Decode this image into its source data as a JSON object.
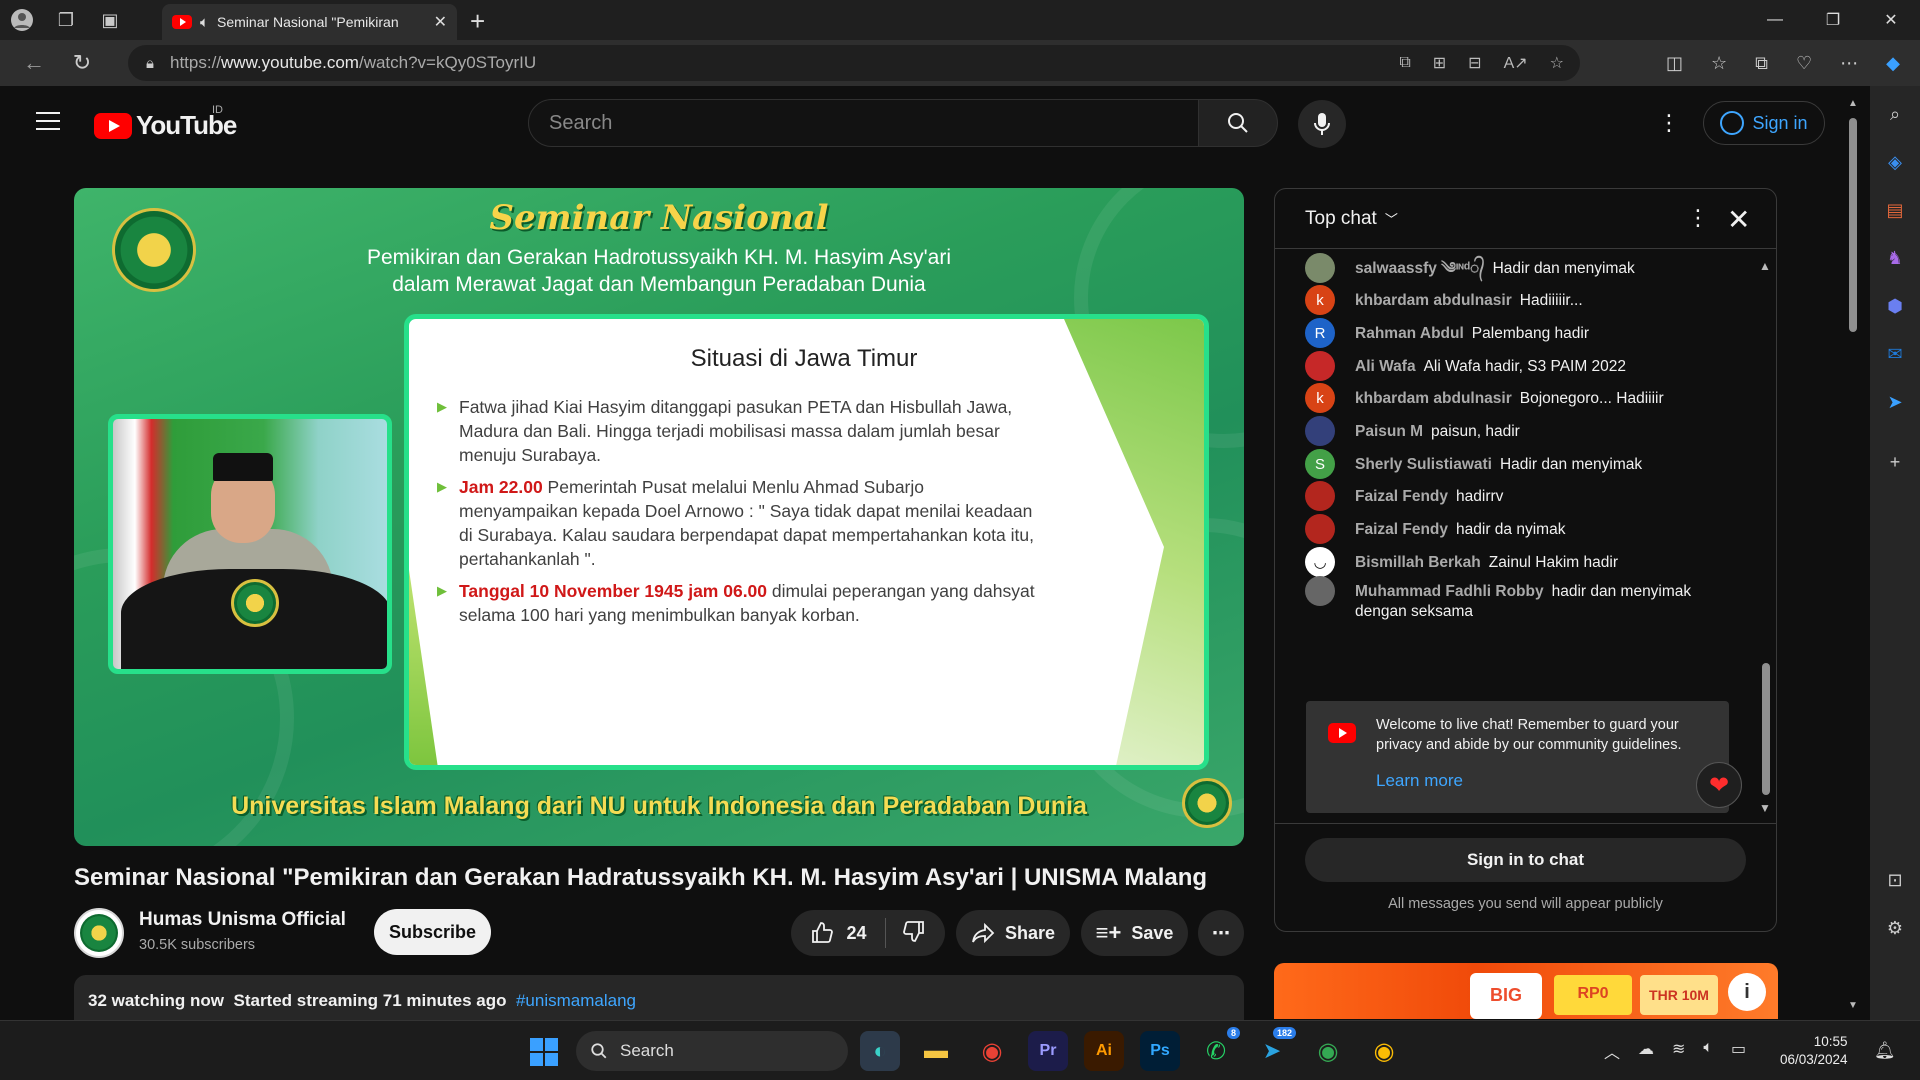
{
  "browser": {
    "tab_title": "Seminar Nasional \"Pemikiran",
    "url_prefix": "https://",
    "url_domain": "www.youtube.com",
    "url_path": "/watch?v=kQy0SToyrIU",
    "new_tab": "+",
    "close_tab": "✕"
  },
  "masthead": {
    "logo_text": "YouTube",
    "country_code": "ID",
    "search_placeholder": "Search",
    "signin_label": "Sign in"
  },
  "slide": {
    "title": "Seminar Nasional",
    "subtitle_line1": "Pemikiran dan Gerakan Hadrotussyaikh KH. M. Hasyim Asy'ari",
    "subtitle_line2": "dalam Merawat Jagat dan Membangun Peradaban Dunia",
    "card_heading": "Situasi di Jawa Timur",
    "bullet1": "Fatwa jihad Kiai Hasyim ditanggapi pasukan PETA dan Hisbullah  Jawa, Madura dan Bali. Hingga terjadi mobilisasi massa dalam jumlah besar menuju Surabaya.",
    "bullet2_highlight": "Jam 22.00",
    "bullet2_rest": " Pemerintah Pusat melalui Menlu Ahmad Subarjo menyampaikan kepada Doel Arnowo : \" Saya tidak dapat menilai keadaan di Surabaya. Kalau saudara berpendapat dapat mempertahankan kota itu, pertahankanlah \".",
    "bullet3_highlight": "Tanggal 10 November 1945 jam 06.00",
    "bullet3_rest": " dimulai peperangan yang dahsyat selama 100 hari yang menimbulkan banyak korban.",
    "footer": "Universitas Islam Malang dari NU untuk Indonesia dan Peradaban Dunia",
    "logo_text_top": "UNIVERSITAS ISLAM MALANG",
    "logo_text_bottom": "UNISMA"
  },
  "video": {
    "title": "Seminar Nasional \"Pemikiran dan Gerakan Hadratussyaikh KH. M. Hasyim Asy'ari | UNISMA Malang",
    "channel_name": "Humas Unisma Official",
    "subscribers": "30.5K subscribers",
    "subscribe_label": "Subscribe",
    "like_count": "24",
    "share_label": "Share",
    "save_label": "Save",
    "watching": "32 watching now",
    "started": "Started streaming 71 minutes ago",
    "hashtag": "#unismamalang"
  },
  "chat": {
    "header": "Top chat",
    "messages": [
      {
        "author": "salwaassfy ༄ᶦᶰᵈ᭄",
        "text": "Hadir dan menyimak",
        "avatar_letter": "",
        "avatar_color": "#7a8a6a"
      },
      {
        "author": "khbardam abdulnasir",
        "text": "Hadiiiiir...",
        "avatar_letter": "k",
        "avatar_color": "#d84315"
      },
      {
        "author": "Rahman Abdul",
        "text": "Palembang hadir",
        "avatar_letter": "R",
        "avatar_color": "#1e63c8"
      },
      {
        "author": "Ali Wafa",
        "text": "Ali Wafa hadir, S3 PAIM 2022",
        "avatar_letter": "",
        "avatar_color": "#c62828"
      },
      {
        "author": "khbardam abdulnasir",
        "text": "Bojonegoro... Hadiiiir",
        "avatar_letter": "k",
        "avatar_color": "#d84315"
      },
      {
        "author": "Paisun M",
        "text": "paisun, hadir",
        "avatar_letter": "",
        "avatar_color": "#33407a"
      },
      {
        "author": "Sherly Sulistiawati",
        "text": "Hadir dan menyimak",
        "avatar_letter": "S",
        "avatar_color": "#43a047"
      },
      {
        "author": "Faizal Fendy",
        "text": "hadirrv",
        "avatar_letter": "",
        "avatar_color": "#b3261e"
      },
      {
        "author": "Faizal Fendy",
        "text": "hadir da nyimak",
        "avatar_letter": "",
        "avatar_color": "#b3261e"
      },
      {
        "author": "Bismillah Berkah",
        "text": "Zainul Hakim hadir",
        "avatar_letter": "◡",
        "avatar_color": "#ffffff"
      },
      {
        "author": "Muhammad Fadhli Robby",
        "text": "hadir dan menyimak dengan seksama",
        "avatar_letter": "",
        "avatar_color": "#666666"
      }
    ],
    "welcome_text": "Welcome to live chat! Remember to guard your privacy and abide by our community guidelines.",
    "learn_more": "Learn more",
    "signin_chat": "Sign in to chat",
    "public_note": "All messages you send will appear publicly"
  },
  "ad": {
    "big": "BIG",
    "rp": "RP0",
    "thr": "THR 10M"
  },
  "taskbar": {
    "search_label": "Search",
    "time": "10:55",
    "date": "06/03/2024",
    "whatsapp_badge": "8",
    "telegram_badge": "182"
  },
  "colors": {
    "accent_blue": "#3ea6ff",
    "yt_red": "#ff0000",
    "slide_green": "#27e08a",
    "highlight_red": "#d01818"
  }
}
